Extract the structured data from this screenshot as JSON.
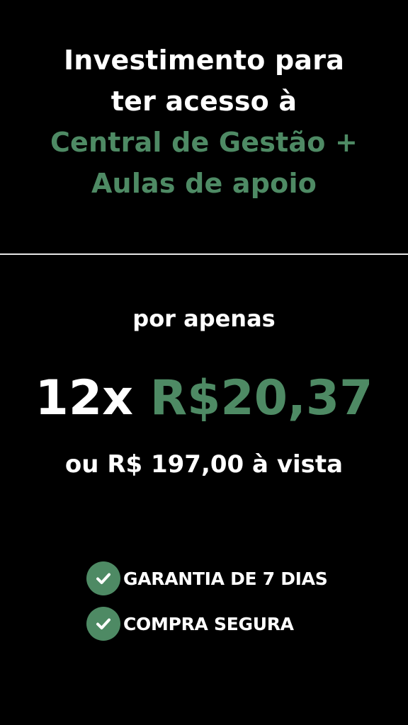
{
  "header": {
    "line1": "Investimento para",
    "line2": "ter acesso à",
    "line3": "Central de Gestão +",
    "line4": "Aulas de apoio"
  },
  "offer": {
    "lead": "por apenas",
    "installments": "12x",
    "installment_price": "R$20,37",
    "cash_price": "ou R$ 197,00 à vista"
  },
  "badges": [
    {
      "icon": "check-circle-icon",
      "label": "GARANTIA DE 7 DIAS"
    },
    {
      "icon": "check-circle-icon",
      "label": "COMPRA SEGURA"
    }
  ],
  "colors": {
    "background": "#000000",
    "text": "#ffffff",
    "accent": "#4e8a64"
  }
}
